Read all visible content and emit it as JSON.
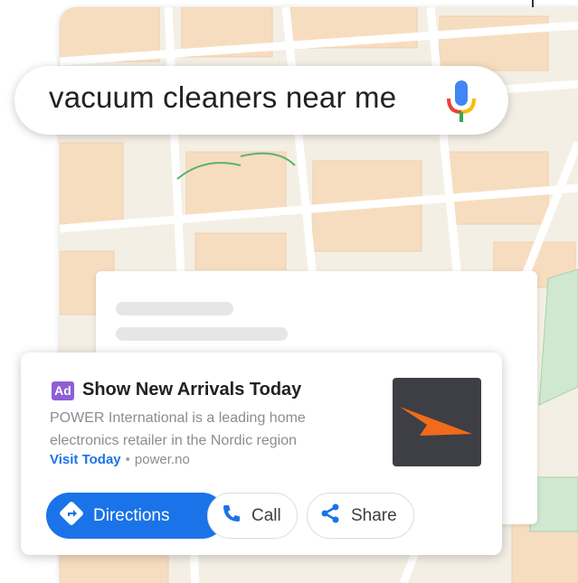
{
  "search": {
    "query": "vacuum cleaners near me"
  },
  "ad": {
    "badge": "Ad",
    "title": "Show New Arrivals Today",
    "description_line1": "POWER International is a leading home",
    "description_line2": "electronics retailer in the Nordic region",
    "link_label": "Visit Today",
    "separator": "•",
    "domain": "power.no"
  },
  "actions": {
    "directions_label": "Directions",
    "call_label": "Call",
    "share_label": "Share"
  },
  "icons": {
    "mic": "mic-icon",
    "directions": "directions-icon",
    "call": "phone-icon",
    "share": "share-icon",
    "logo": "power-logo"
  },
  "colors": {
    "primary_blue": "#1a73e8",
    "ad_badge": "#8e5fd6",
    "logo_orange": "#f26a1b",
    "logo_background": "#3d3f44"
  }
}
